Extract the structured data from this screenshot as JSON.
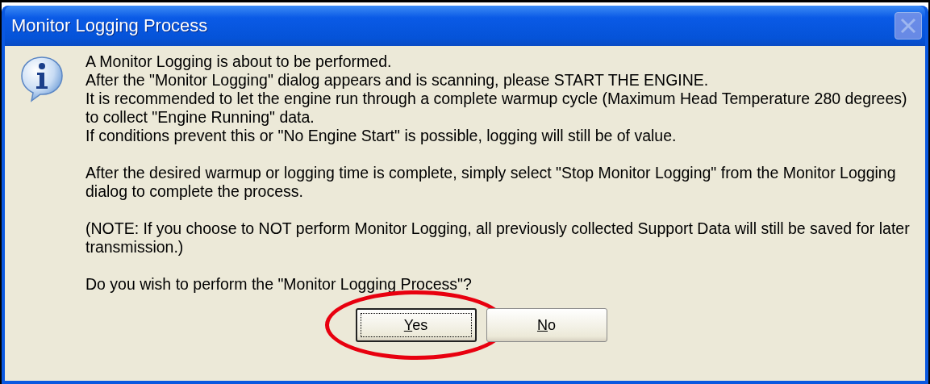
{
  "window": {
    "title": "Monitor Logging Process",
    "close_enabled": false
  },
  "paragraphs": [
    {
      "lines": [
        "A Monitor Logging is about to be performed.",
        "After the \"Monitor Logging\" dialog appears and is scanning, please START THE ENGINE.",
        "It is recommended to let the engine run through a complete warmup cycle (Maximum Head Temperature 280 degrees)",
        "to collect \"Engine Running\" data.",
        "If conditions prevent this or \"No Engine Start\" is possible, logging will still be of value."
      ]
    },
    {
      "lines": [
        "After the desired warmup or logging time is complete, simply select \"Stop Monitor Logging\" from the Monitor Logging",
        "dialog to complete the process."
      ]
    },
    {
      "lines": [
        "(NOTE: If you choose to NOT perform Monitor Logging, all previously collected Support Data will still be saved for later",
        "transmission.)"
      ]
    },
    {
      "lines": [
        "Do you wish to perform the \"Monitor Logging Process\"?"
      ]
    }
  ],
  "buttons": [
    {
      "label": "Yes",
      "mnemonic_first": true,
      "focused": true,
      "highlighted": true
    },
    {
      "label": "No",
      "mnemonic_first": true,
      "focused": false,
      "highlighted": false
    }
  ]
}
